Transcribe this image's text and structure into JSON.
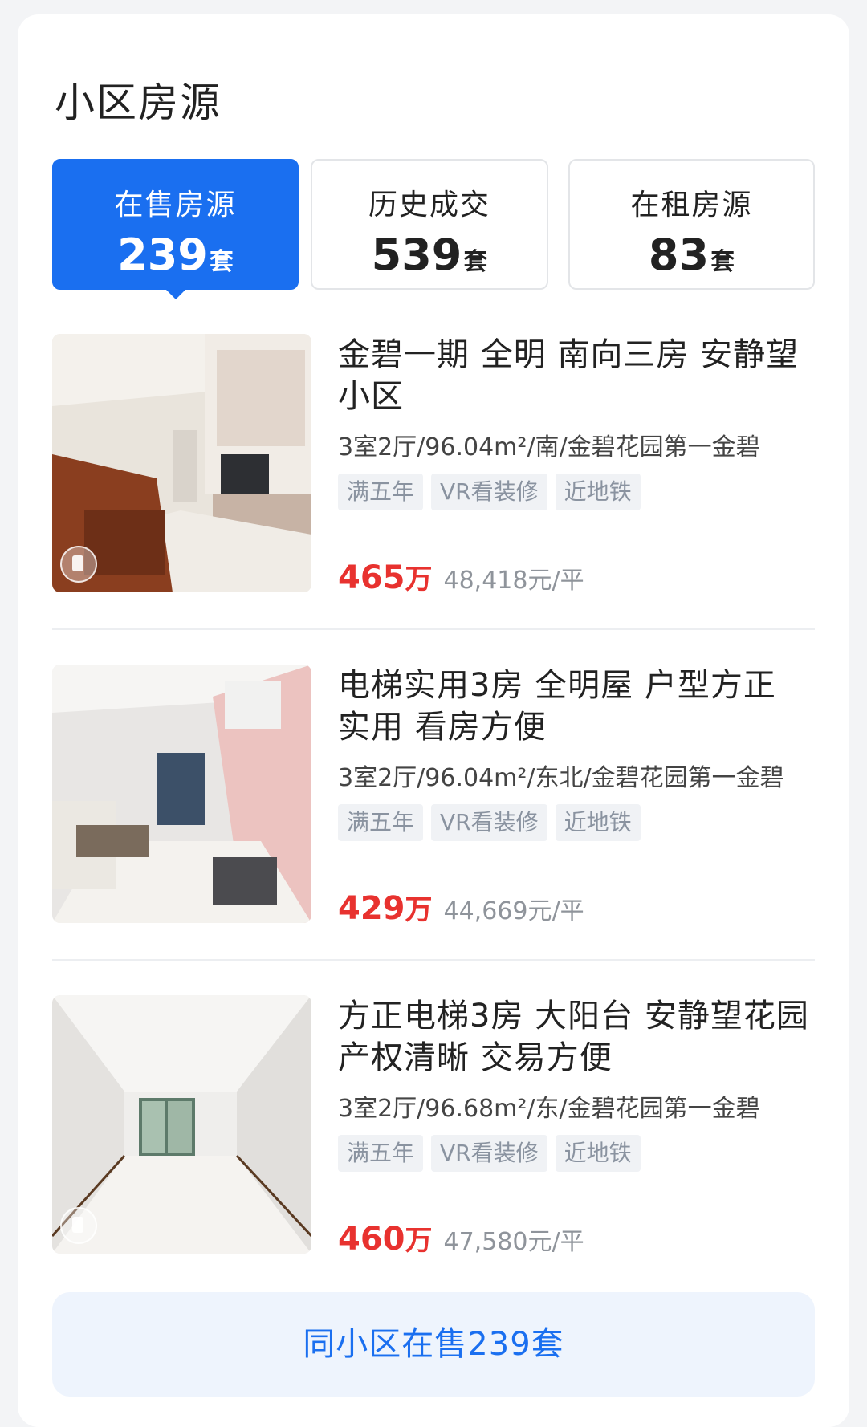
{
  "section": {
    "title": "小区房源"
  },
  "tabs": [
    {
      "label": "在售房源",
      "count": "239",
      "unit": "套",
      "active": true
    },
    {
      "label": "历史成交",
      "count": "539",
      "unit": "套",
      "active": false
    },
    {
      "label": "在租房源",
      "count": "83",
      "unit": "套",
      "active": false
    }
  ],
  "listings": [
    {
      "title": "金碧一期  全明  南向三房  安静望小区",
      "meta": "3室2厅/96.04m²/南/金碧花园第一金碧",
      "tags": [
        "满五年",
        "VR看装修",
        "近地铁"
      ],
      "price": "465",
      "price_unit": "万",
      "unit_price": "48,418元/平"
    },
    {
      "title": "电梯实用3房 全明屋 户型方正 实用 看房方便",
      "meta": "3室2厅/96.04m²/东北/金碧花园第一金碧",
      "tags": [
        "满五年",
        "VR看装修",
        "近地铁"
      ],
      "price": "429",
      "price_unit": "万",
      "unit_price": "44,669元/平"
    },
    {
      "title": "方正电梯3房 大阳台 安静望花园 产权清晰 交易方便",
      "meta": "3室2厅/96.68m²/东/金碧花园第一金碧",
      "tags": [
        "满五年",
        "VR看装修",
        "近地铁"
      ],
      "price": "460",
      "price_unit": "万",
      "unit_price": "47,580元/平"
    }
  ],
  "footer": {
    "more_label": "同小区在售239套"
  },
  "colors": {
    "accent": "#1a6ff0",
    "price": "#e8322f",
    "tag_bg": "#f0f2f5",
    "tag_text": "#8a93a0"
  }
}
